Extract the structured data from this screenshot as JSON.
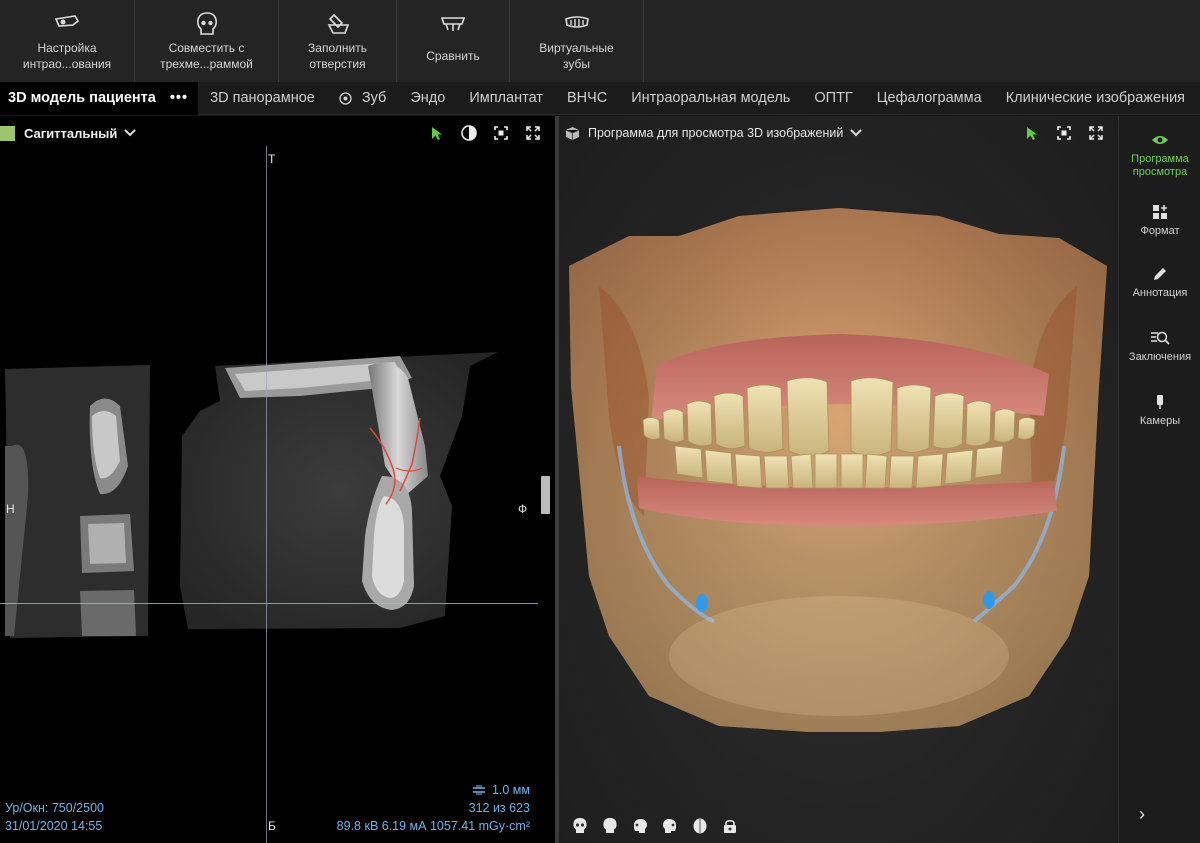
{
  "toolbar": {
    "tools": [
      {
        "label": "Настройка\nинтрао...ования",
        "icon": "intraoral-scan-icon"
      },
      {
        "label": "Совместить с\nтрехме...раммой",
        "icon": "skull-icon"
      },
      {
        "label": "Заполнить\nотверстия",
        "icon": "fill-holes-icon"
      },
      {
        "label": "Сравнить",
        "icon": "compare-icon"
      },
      {
        "label": "Виртуальные\nзубы",
        "icon": "virtual-teeth-icon"
      }
    ]
  },
  "tabs": {
    "active": "3D модель пациента",
    "more": "•••",
    "items": [
      "3D панорамное",
      "Зуб",
      "Эндо",
      "Имплантат",
      "ВНЧС",
      "Интраоральная модель",
      "ОПТГ",
      "Цефалограмма",
      "Клинические изображения"
    ]
  },
  "left_panel": {
    "title": "Сагиттальный",
    "swatch_color": "#9bc76c",
    "orient": {
      "top": "Т",
      "left": "Н",
      "right": "Ф",
      "bottom": "Б"
    },
    "level_window": "Ур/Окн: 750/2500",
    "datetime": "31/01/2020 14:55",
    "slice_thickness": "1.0 мм",
    "slice_index": "312 из 623",
    "exposure": "89.8 кВ  6.19 мА  1057.41 mGy·cm²",
    "icons": [
      "pointer-icon",
      "contrast-icon",
      "fit-icon",
      "fullscreen-icon"
    ]
  },
  "right_panel": {
    "title": "Программа для просмотра 3D изображений",
    "icons": [
      "pointer-icon",
      "fit-icon",
      "fullscreen-icon"
    ],
    "bottom_icons": [
      "skull-front-icon",
      "skull-back-icon",
      "skull-left-icon",
      "skull-right-icon",
      "skull-top-icon",
      "skull-lock-icon"
    ]
  },
  "side_panel": {
    "items": [
      {
        "label": "Программа\nпросмотра",
        "icon": "eye-icon",
        "active": true
      },
      {
        "label": "Формат",
        "icon": "layout-icon",
        "active": false
      },
      {
        "label": "Аннотация",
        "icon": "pencil-icon",
        "active": false
      },
      {
        "label": "Заключения",
        "icon": "findings-icon",
        "active": false
      },
      {
        "label": "Камеры",
        "icon": "camera-icon",
        "active": false
      }
    ],
    "expand": "›"
  },
  "colors": {
    "accent_green": "#6fcf4f",
    "info_blue": "#6fb4e8"
  }
}
